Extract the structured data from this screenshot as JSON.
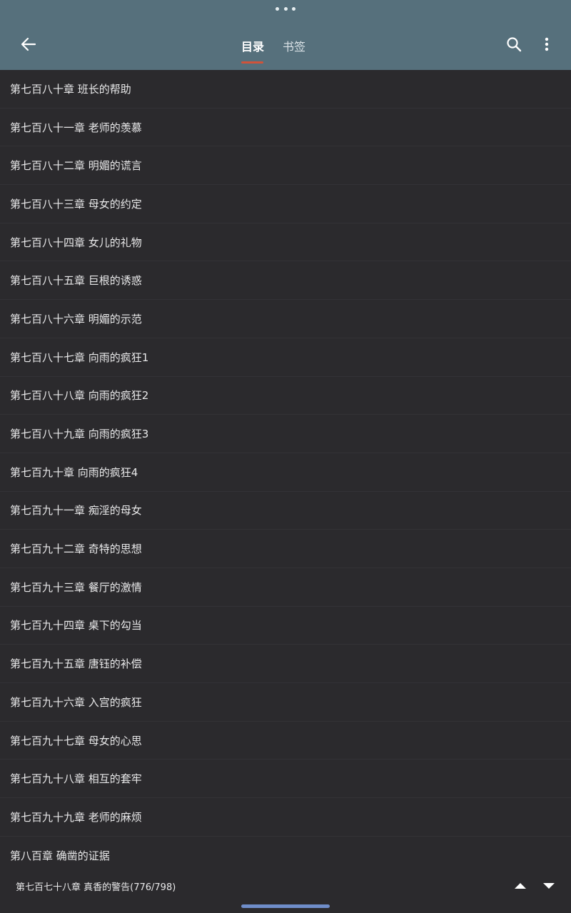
{
  "header": {
    "tabs": [
      {
        "label": "目录",
        "active": true
      },
      {
        "label": "书签",
        "active": false
      }
    ],
    "icons": {
      "back": "back-arrow-icon",
      "search": "search-icon",
      "more": "more-vertical-icon"
    }
  },
  "chapters": [
    "第七百八十章 班长的帮助",
    "第七百八十一章 老师的羡慕",
    "第七百八十二章 明媚的谎言",
    "第七百八十三章 母女的约定",
    "第七百八十四章 女儿的礼物",
    "第七百八十五章 巨根的诱惑",
    "第七百八十六章 明媚的示范",
    "第七百八十七章 向雨的疯狂1",
    "第七百八十八章 向雨的疯狂2",
    "第七百八十九章 向雨的疯狂3",
    "第七百九十章 向雨的疯狂4",
    "第七百九十一章 痴淫的母女",
    "第七百九十二章 奇特的思想",
    "第七百九十三章 餐厅的激情",
    "第七百九十四章 桌下的勾当",
    "第七百九十五章 唐钰的补偿",
    "第七百九十六章 入宫的疯狂",
    "第七百九十七章 母女的心思",
    "第七百九十八章 相互的套牢",
    "第七百九十九章 老师的麻烦",
    "第八百章 确凿的证据"
  ],
  "footer": {
    "current_chapter": "第七百七十八章 真香的警告(776/798)"
  },
  "colors": {
    "header_bg": "#56707c",
    "page_bg": "#2b2a2d",
    "tab_indicator": "#d0533a",
    "home_indicator": "#6f8dc9"
  }
}
